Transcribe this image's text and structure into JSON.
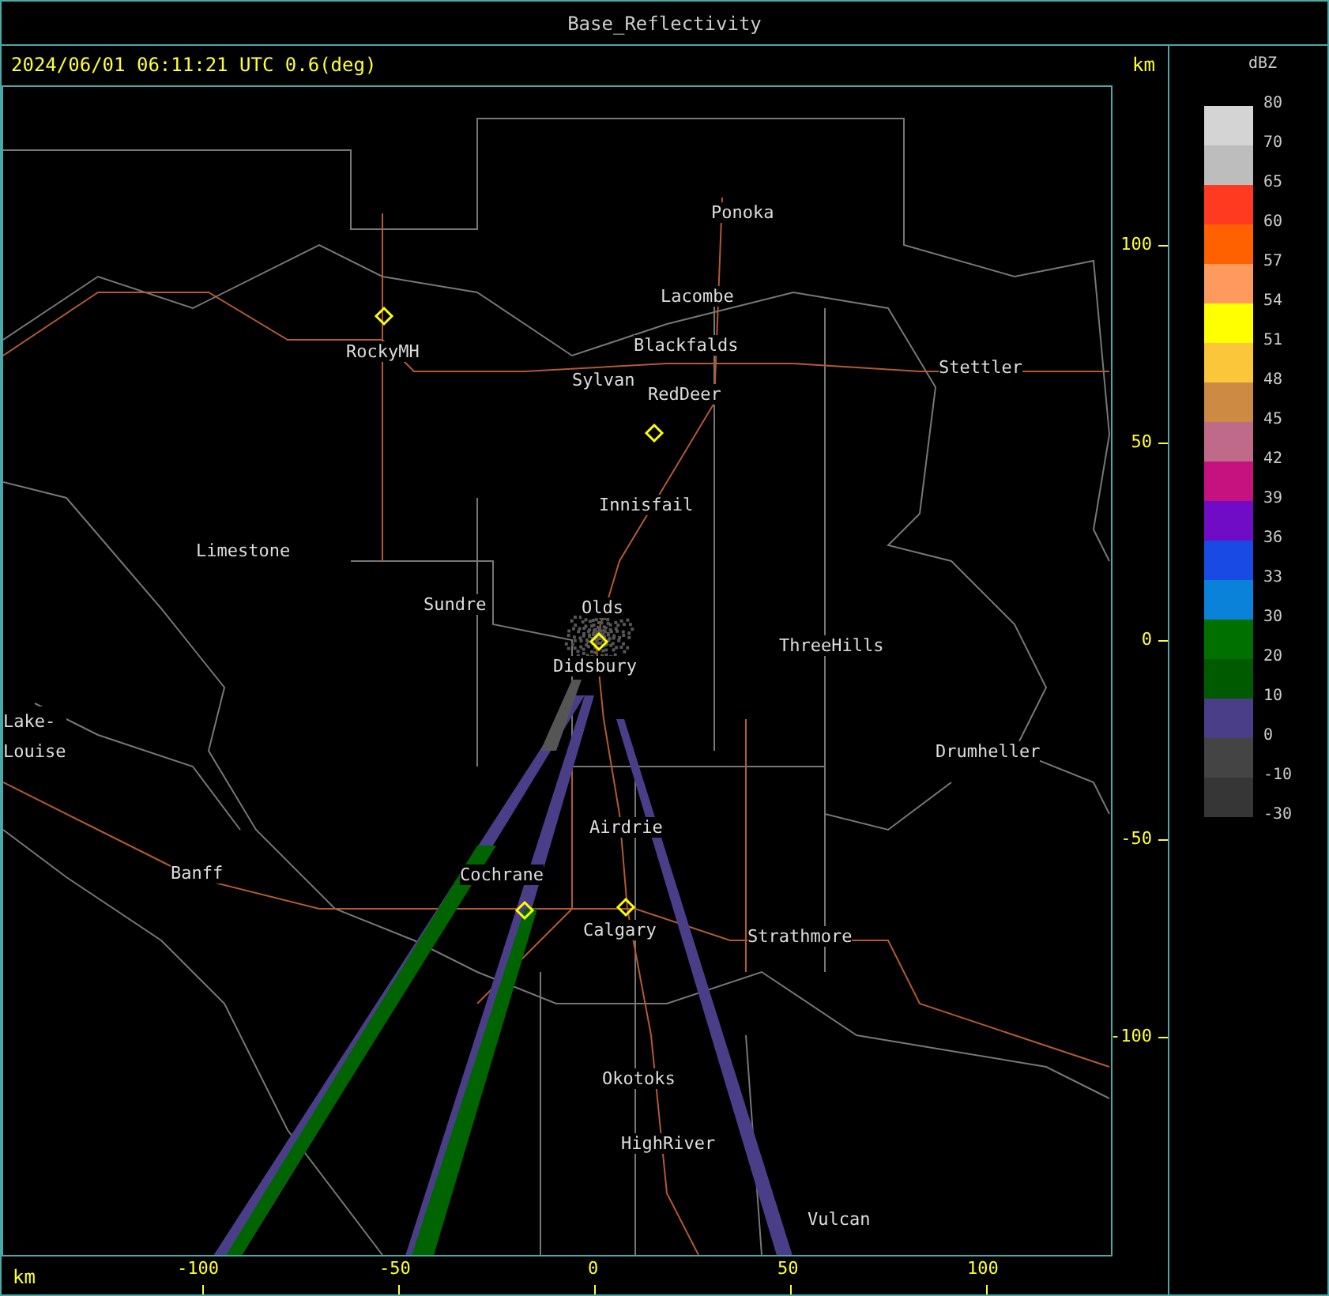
{
  "title": "Base_Reflectivity",
  "header": {
    "timestamp": "2024/06/01 06:11:21 UTC 0.6(deg)",
    "unit": "km"
  },
  "map": {
    "places": [
      {
        "name": "Ponoka"
      },
      {
        "name": "Lacombe"
      },
      {
        "name": "Blackfalds"
      },
      {
        "name": "Stettler"
      },
      {
        "name": "RockyMH"
      },
      {
        "name": "Sylvan"
      },
      {
        "name": "RedDeer"
      },
      {
        "name": "Innisfail"
      },
      {
        "name": "Limestone"
      },
      {
        "name": "Sundre"
      },
      {
        "name": "Olds"
      },
      {
        "name": "ThreeHills"
      },
      {
        "name": "Didsbury"
      },
      {
        "name": "Lake-Louise"
      },
      {
        "name": "Drumheller"
      },
      {
        "name": "Airdrie"
      },
      {
        "name": "Banff"
      },
      {
        "name": "Cochrane"
      },
      {
        "name": "Calgary"
      },
      {
        "name": "Strathmore"
      },
      {
        "name": "Okotoks"
      },
      {
        "name": "HighRiver"
      },
      {
        "name": "Vulcan"
      }
    ]
  },
  "y_axis": {
    "ticks": [
      "100",
      "50",
      "0",
      "-50",
      "-100"
    ]
  },
  "x_axis": {
    "unit": "km",
    "ticks": [
      "-100",
      "-50",
      "0",
      "50",
      "100"
    ]
  },
  "legend": {
    "unit": "dBZ",
    "labels": [
      "80",
      "70",
      "65",
      "60",
      "57",
      "54",
      "51",
      "48",
      "45",
      "42",
      "39",
      "36",
      "33",
      "30",
      "20",
      "10",
      "0",
      "-10",
      "-30"
    ],
    "bins": [
      {
        "color": "#d4d4d4"
      },
      {
        "color": "#bdbdbd"
      },
      {
        "color": "#ff3a20"
      },
      {
        "color": "#ff6000"
      },
      {
        "color": "#ff9a5e"
      },
      {
        "color": "#ffff00"
      },
      {
        "color": "#fbc63a"
      },
      {
        "color": "#cd8a42"
      },
      {
        "color": "#bf6a88"
      },
      {
        "color": "#c5127e"
      },
      {
        "color": "#700cc5"
      },
      {
        "color": "#1a4ae4"
      },
      {
        "color": "#0a82da"
      },
      {
        "color": "#007000"
      },
      {
        "color": "#005a00"
      },
      {
        "color": "#4a3e88"
      },
      {
        "color": "#444444"
      },
      {
        "color": "#363636"
      }
    ]
  }
}
